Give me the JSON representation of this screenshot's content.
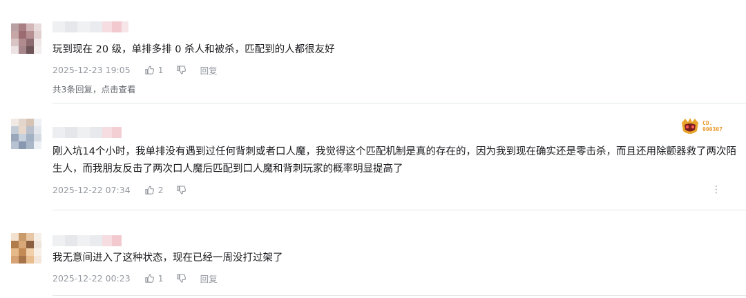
{
  "comments": [
    {
      "text": "玩到现在 20 级，单排多排 0 杀人和被杀，匹配到的人都很友好",
      "time": "2025-12-23 19:05",
      "likes": "1",
      "reply_label": "回复",
      "replies_hint": "共3条回复，点击查看"
    },
    {
      "text": "刚入坑14个小时，我单排没有遇到过任何背刺或者口人魔，我觉得这个匹配机制是真的存在的，因为我到现在确实还是零击杀，而且还用除颤器救了两次陌生人，而我朋友反击了两次口人魔后匹配到口人魔和背刺玩家的概率明显提高了",
      "time": "2025-12-22 07:34",
      "likes": "2",
      "badge_text": "CD.\n000307"
    },
    {
      "text": "我无意间进入了这种状态，现在已经一周没打过架了",
      "time": "2025-12-22 00:23",
      "likes": "1",
      "reply_label": "回复"
    }
  ],
  "colors": {
    "meta_gray": "#9499a0",
    "divider": "#e3e5e7",
    "badge_orange": "#e89a2a"
  },
  "icons": {
    "like": "thumbs-up-icon",
    "dislike": "thumbs-down-icon",
    "more": "more-vertical-icon"
  }
}
